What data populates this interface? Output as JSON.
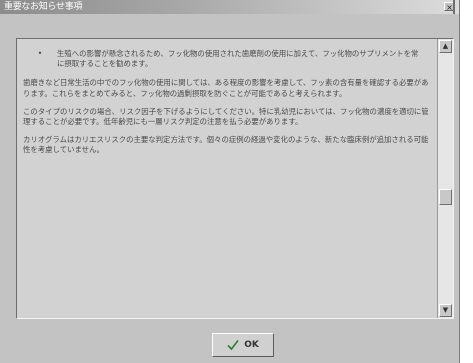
{
  "window": {
    "title": "重要なお知らせ事項"
  },
  "message": {
    "bullet_symbol": "•",
    "bullet_text": "生殖への影響が懸念されるため、フッ化物の使用された歯磨剤の使用に加えて、フッ化物のサプリメントを常に摂取することを勧めます。",
    "paragraphs": [
      "歯磨きなど日常生活の中でのフッ化物の使用に関しては、ある程度の影響を考慮して、フッ素の含有量を確認する必要があります。これらをまとめてみると、フッ化物の過剰摂取を防ぐことが可能であると考えられます。",
      "このタイプのリスクの場合、リスク因子を下げるようにしてください。特に乳幼児においては、フッ化物の濃度を適切に管理することが必要です。低年齢児にも一層リスク判定の注意を払う必要があります。",
      "カリオグラムはカリエスリスクの主要な判定方法です。個々の症例の経過や変化のような、新たな臨床例が追加される可能性を考慮していません。"
    ]
  },
  "scrollbar": {
    "up_icon": "triangle-up",
    "down_icon": "triangle-down"
  },
  "buttons": {
    "ok_label": "OK",
    "ok_icon": "checkmark-icon"
  },
  "colors": {
    "dialog_bg": "#c3c3c3",
    "panel_bg": "#d2d2d2",
    "text": "#4a4a4a",
    "check_green": "#2e7d32"
  }
}
